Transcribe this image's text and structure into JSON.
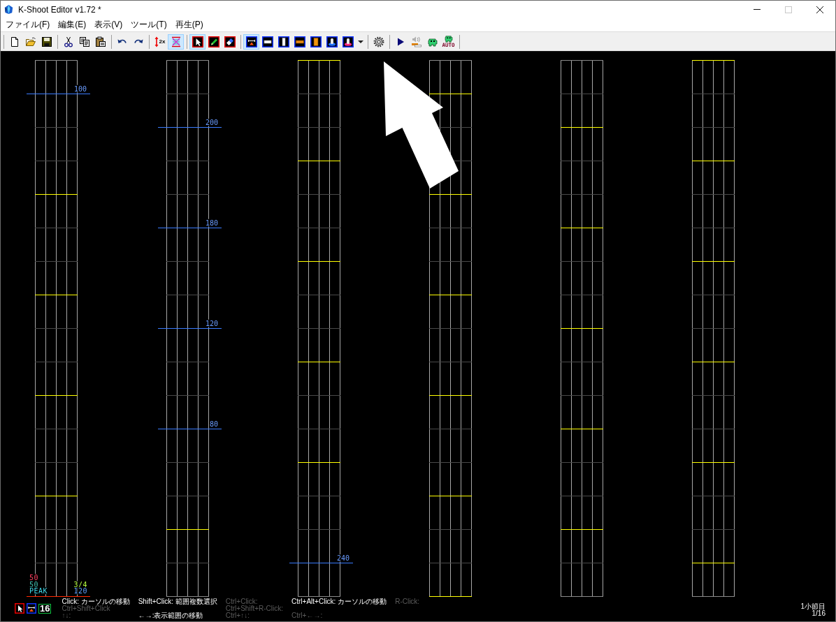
{
  "window": {
    "title": "K-Shoot Editor v1.72 *",
    "controls": [
      {
        "kind": "minimize",
        "disabled": false
      },
      {
        "kind": "maximize",
        "disabled": true
      },
      {
        "kind": "close",
        "disabled": false
      }
    ]
  },
  "menu": [
    "ファイル(F)",
    "編集(E)",
    "表示(V)",
    "ツール(T)",
    "再生(P)"
  ],
  "toolbar": [
    [
      {
        "kind": "new",
        "selected": false
      },
      {
        "kind": "open",
        "selected": false
      },
      {
        "kind": "save",
        "selected": false
      }
    ],
    [
      {
        "kind": "cut",
        "selected": false
      },
      {
        "kind": "copy",
        "selected": false
      },
      {
        "kind": "paste",
        "selected": false
      }
    ],
    [
      {
        "kind": "undo",
        "selected": false
      },
      {
        "kind": "redo",
        "selected": false
      }
    ],
    [
      {
        "kind": "zoom",
        "label": "2x",
        "selected": false
      },
      {
        "kind": "fit",
        "selected": true
      }
    ],
    [
      {
        "kind": "select",
        "selected": true
      },
      {
        "kind": "pencil",
        "selected": false
      },
      {
        "kind": "eraser",
        "selected": false
      }
    ],
    [
      {
        "kind": "slam",
        "selected": true
      },
      {
        "kind": "bt-chip",
        "selected": false
      },
      {
        "kind": "bt-long",
        "selected": false
      },
      {
        "kind": "fx-chip",
        "selected": false
      },
      {
        "kind": "fx-long",
        "selected": false
      },
      {
        "kind": "knob-left",
        "selected": false
      },
      {
        "kind": "knob-right",
        "selected": false
      },
      {
        "kind": "dropdown",
        "selected": false
      }
    ],
    [
      {
        "kind": "settings",
        "selected": false
      }
    ],
    [
      {
        "kind": "play",
        "selected": false
      },
      {
        "kind": "sound",
        "selected": false
      },
      {
        "kind": "robot",
        "selected": false
      },
      {
        "kind": "robot-auto",
        "label": "AUTO",
        "selected": false
      }
    ]
  ],
  "chart": {
    "lanes": [
      {
        "lines": [
          {
            "kind": "beat"
          },
          {
            "kind": "bpm",
            "label": "100"
          },
          {
            "kind": "beat"
          },
          {
            "kind": "beat"
          },
          {
            "kind": "measure"
          },
          {
            "kind": "beat"
          },
          {
            "kind": "beat"
          },
          {
            "kind": "measure"
          },
          {
            "kind": "beat"
          },
          {
            "kind": "beat"
          },
          {
            "kind": "measure"
          },
          {
            "kind": "beat"
          },
          {
            "kind": "beat"
          },
          {
            "kind": "measure"
          },
          {
            "kind": "beat"
          },
          {
            "kind": "beat"
          },
          {
            "kind": "cursor"
          }
        ]
      },
      {
        "lines": [
          {
            "kind": "beat"
          },
          {
            "kind": "beat"
          },
          {
            "kind": "bpm",
            "label": "200"
          },
          {
            "kind": "beat"
          },
          {
            "kind": "beat"
          },
          {
            "kind": "bpm",
            "label": "180"
          },
          {
            "kind": "beat"
          },
          {
            "kind": "beat"
          },
          {
            "kind": "bpm",
            "label": "120"
          },
          {
            "kind": "beat"
          },
          {
            "kind": "beat"
          },
          {
            "kind": "bpm",
            "label": "80"
          },
          {
            "kind": "beat"
          },
          {
            "kind": "beat"
          },
          {
            "kind": "measure"
          },
          {
            "kind": "beat"
          },
          {
            "kind": "beat"
          }
        ]
      },
      {
        "lines": [
          {
            "kind": "measure"
          },
          {
            "kind": "beat"
          },
          {
            "kind": "beat"
          },
          {
            "kind": "measure"
          },
          {
            "kind": "beat"
          },
          {
            "kind": "beat"
          },
          {
            "kind": "measure"
          },
          {
            "kind": "beat"
          },
          {
            "kind": "beat"
          },
          {
            "kind": "measure"
          },
          {
            "kind": "beat"
          },
          {
            "kind": "beat"
          },
          {
            "kind": "measure"
          },
          {
            "kind": "beat"
          },
          {
            "kind": "beat"
          },
          {
            "kind": "bpm",
            "label": "240"
          },
          {
            "kind": "beat"
          }
        ]
      },
      {
        "lines": [
          {
            "kind": "beat"
          },
          {
            "kind": "measure"
          },
          {
            "kind": "beat"
          },
          {
            "kind": "beat"
          },
          {
            "kind": "measure"
          },
          {
            "kind": "beat"
          },
          {
            "kind": "beat"
          },
          {
            "kind": "measure"
          },
          {
            "kind": "beat"
          },
          {
            "kind": "beat"
          },
          {
            "kind": "measure"
          },
          {
            "kind": "beat"
          },
          {
            "kind": "beat"
          },
          {
            "kind": "measure"
          },
          {
            "kind": "beat"
          },
          {
            "kind": "beat"
          },
          {
            "kind": "measure"
          }
        ]
      },
      {
        "lines": [
          {
            "kind": "beat"
          },
          {
            "kind": "beat"
          },
          {
            "kind": "measure"
          },
          {
            "kind": "beat"
          },
          {
            "kind": "beat"
          },
          {
            "kind": "measure"
          },
          {
            "kind": "beat"
          },
          {
            "kind": "beat"
          },
          {
            "kind": "measure"
          },
          {
            "kind": "beat"
          },
          {
            "kind": "beat"
          },
          {
            "kind": "measure"
          },
          {
            "kind": "beat"
          },
          {
            "kind": "beat"
          },
          {
            "kind": "measure"
          },
          {
            "kind": "beat"
          },
          {
            "kind": "beat"
          }
        ]
      },
      {
        "lines": [
          {
            "kind": "measure"
          },
          {
            "kind": "beat"
          },
          {
            "kind": "beat"
          },
          {
            "kind": "measure"
          },
          {
            "kind": "beat"
          },
          {
            "kind": "beat"
          },
          {
            "kind": "measure"
          },
          {
            "kind": "beat"
          },
          {
            "kind": "beat"
          },
          {
            "kind": "measure"
          },
          {
            "kind": "beat"
          },
          {
            "kind": "beat"
          },
          {
            "kind": "measure"
          },
          {
            "kind": "beat"
          },
          {
            "kind": "beat"
          },
          {
            "kind": "measure"
          },
          {
            "kind": "beat"
          }
        ]
      }
    ],
    "info_left": [
      {
        "text": "50",
        "color": "#ff4060"
      },
      {
        "text": "50",
        "color": "#40c0b0"
      },
      {
        "text": "PEAK",
        "color": "#40d8e8"
      }
    ],
    "info_right": [
      {
        "text": "3/4",
        "color": "#b8ff40"
      },
      {
        "text": "120",
        "color": "#60a0ff"
      }
    ]
  },
  "overlay": {
    "kind": "arrow"
  },
  "status": {
    "tools": [
      {
        "kind": "select"
      },
      {
        "kind": "slam"
      },
      {
        "kind": "division",
        "label": "16"
      }
    ],
    "hints": [
      {
        "top": {
          "text": "Click: カーソルの移動",
          "disabled": false
        },
        "middle": {
          "text": "Ctrl+Shift+Click",
          "disabled": true
        },
        "bottom": {
          "text": "↑↓:",
          "disabled": true
        }
      },
      {
        "top": {
          "text": "Shift+Click: 範囲複数選択",
          "disabled": false
        },
        "bottom": {
          "text": "←→:表示範囲の移動",
          "disabled": false
        }
      },
      {
        "top": {
          "text": "Ctrl+Click:",
          "disabled": true
        },
        "middle": {
          "text": "Ctrl+Shift+R-Click:",
          "disabled": true
        },
        "bottom": {
          "text": "Ctrl+↑↓:",
          "disabled": true
        }
      },
      {
        "top": {
          "text": "Ctrl+Alt+Click: カーソルの移動",
          "disabled": false
        },
        "bottom": {
          "text": "Ctrl+←→:",
          "disabled": true
        }
      },
      {
        "top": {
          "text": "R-Click:",
          "disabled": true
        }
      }
    ],
    "position": {
      "measure": "1小節目",
      "fraction": "1/16"
    }
  }
}
